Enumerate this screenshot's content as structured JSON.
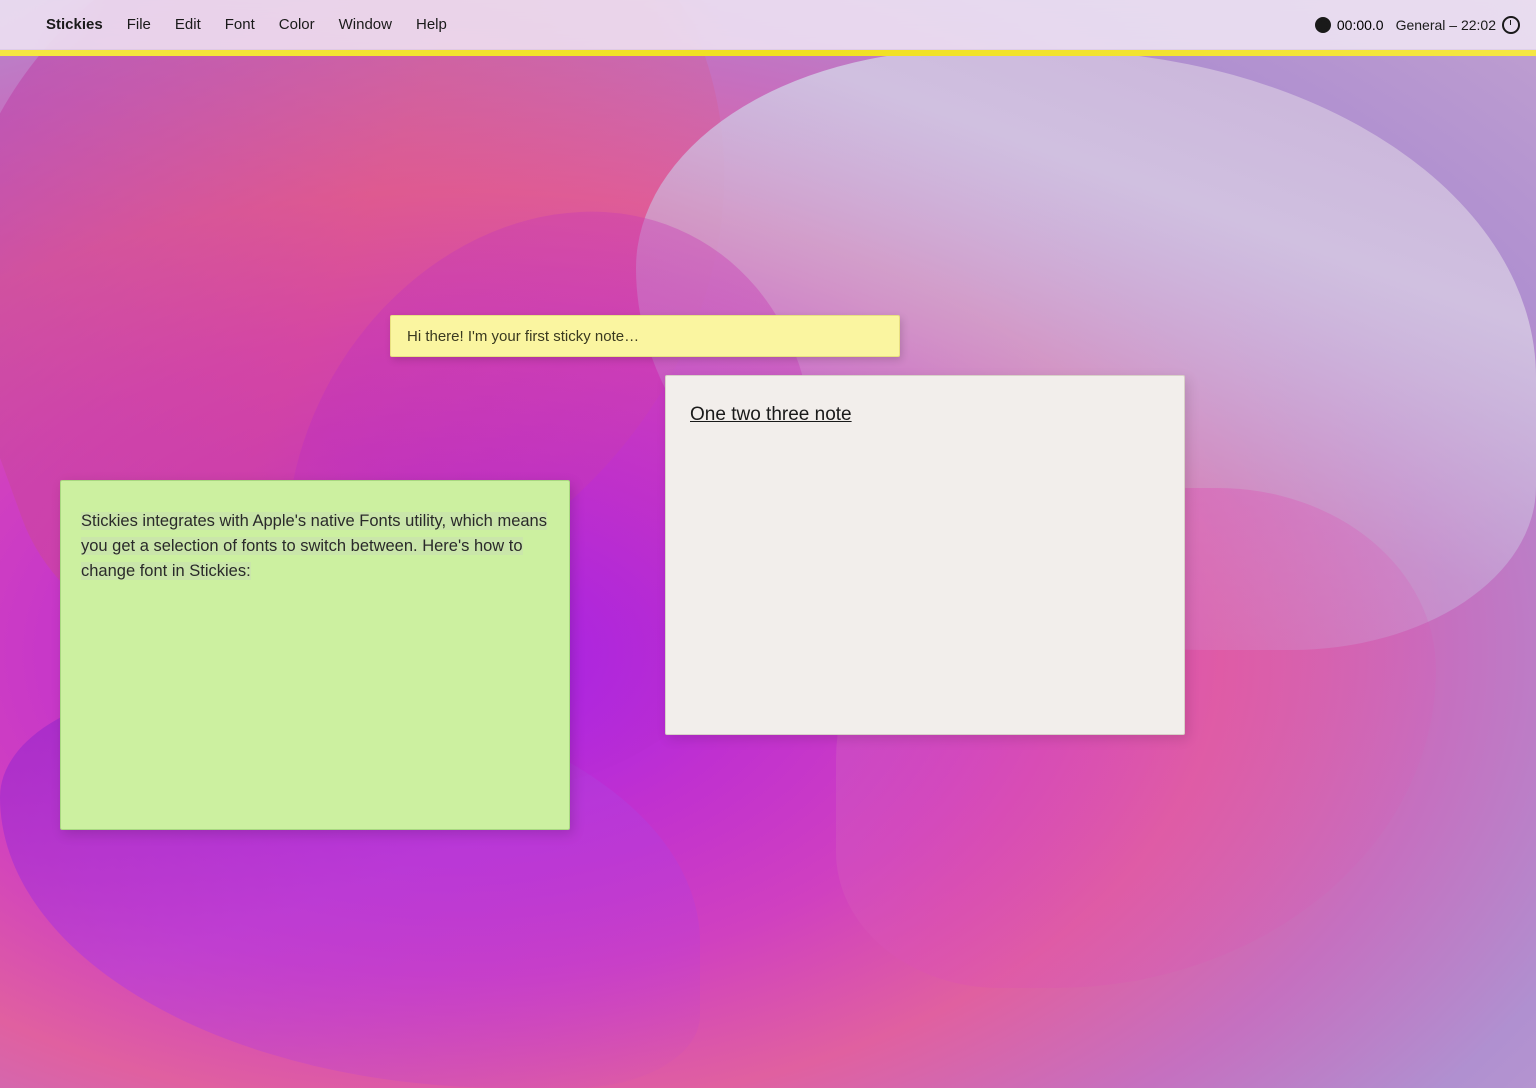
{
  "menubar": {
    "apple_logo": "",
    "app_name": "Stickies",
    "menu_items": [
      "File",
      "Edit",
      "Font",
      "Color",
      "Window",
      "Help"
    ],
    "record_time": "00:00.0",
    "clock_label": "General – 22:02"
  },
  "sticky_notes": {
    "yellow": {
      "text": "Hi there! I'm your first sticky note…"
    },
    "green": {
      "text": "Stickies integrates with Apple's native Fonts utility, which means you get a selection of fonts to switch between. Here's how to change font in Stickies:"
    },
    "white": {
      "title": "One two three note"
    }
  }
}
